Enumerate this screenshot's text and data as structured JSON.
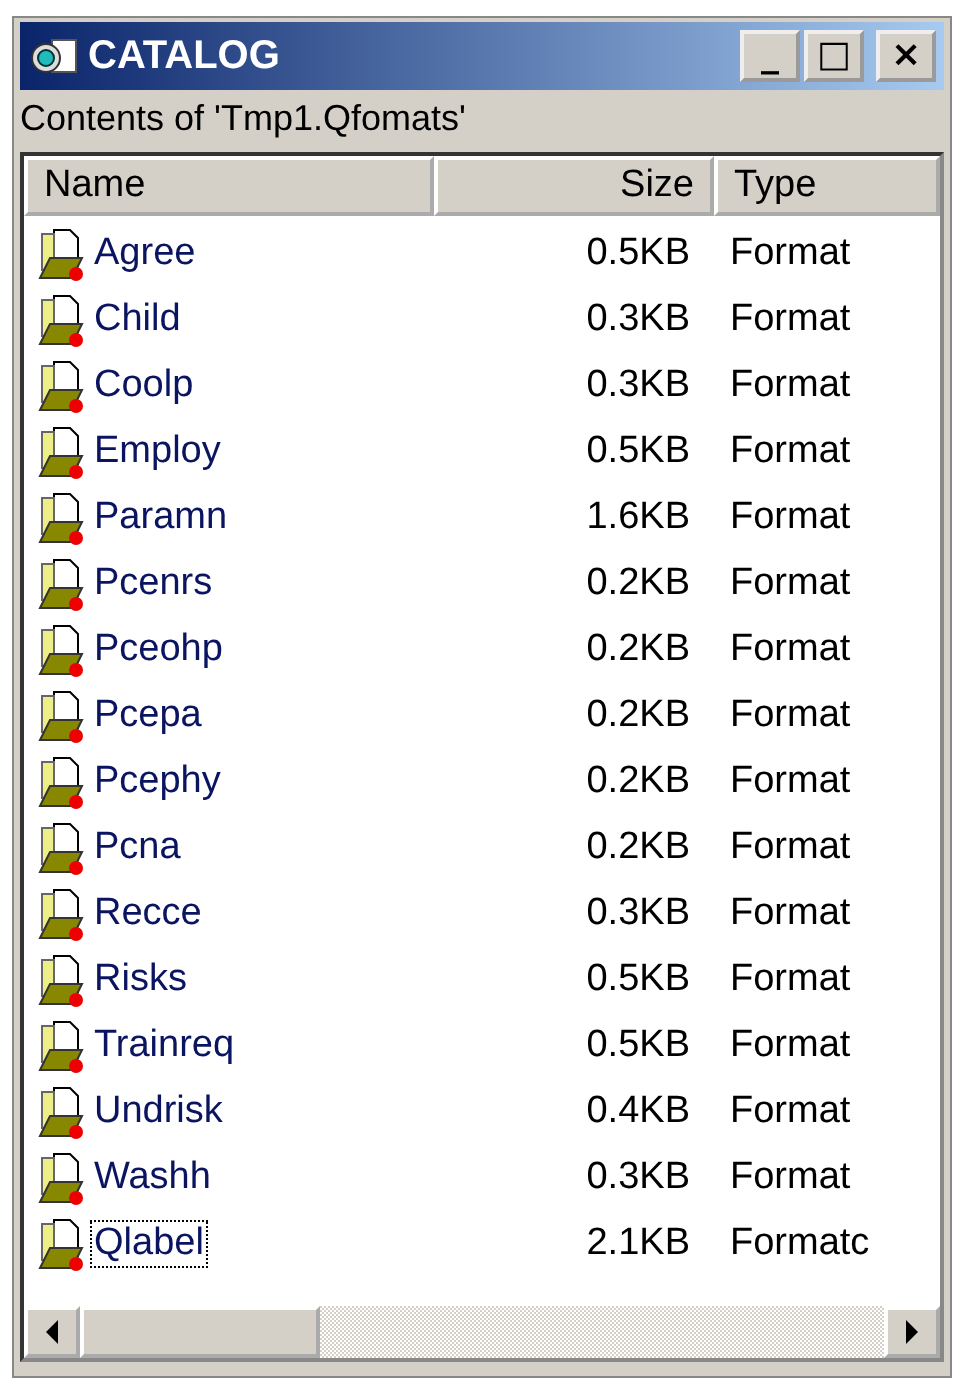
{
  "window": {
    "title": "CATALOG",
    "controls": [
      "_",
      "□",
      "×"
    ]
  },
  "subtitle": "Contents of 'Tmp1.Qfomats'",
  "table": {
    "columns": [
      "Name",
      "Size",
      "Type"
    ],
    "rows": [
      {
        "name": "Agree",
        "size": "0.5KB",
        "type": "Format",
        "focused": false
      },
      {
        "name": "Child",
        "size": "0.3KB",
        "type": "Format",
        "focused": false
      },
      {
        "name": "Coolp",
        "size": "0.3KB",
        "type": "Format",
        "focused": false
      },
      {
        "name": "Employ",
        "size": "0.5KB",
        "type": "Format",
        "focused": false
      },
      {
        "name": "Paramn",
        "size": "1.6KB",
        "type": "Format",
        "focused": false
      },
      {
        "name": "Pcenrs",
        "size": "0.2KB",
        "type": "Format",
        "focused": false
      },
      {
        "name": "Pceohp",
        "size": "0.2KB",
        "type": "Format",
        "focused": false
      },
      {
        "name": "Pcepa",
        "size": "0.2KB",
        "type": "Format",
        "focused": false
      },
      {
        "name": "Pcephy",
        "size": "0.2KB",
        "type": "Format",
        "focused": false
      },
      {
        "name": "Pcna",
        "size": "0.2KB",
        "type": "Format",
        "focused": false
      },
      {
        "name": "Recce",
        "size": "0.3KB",
        "type": "Format",
        "focused": false
      },
      {
        "name": "Risks",
        "size": "0.5KB",
        "type": "Format",
        "focused": false
      },
      {
        "name": "Trainreq",
        "size": "0.5KB",
        "type": "Format",
        "focused": false
      },
      {
        "name": "Undrisk",
        "size": "0.4KB",
        "type": "Format",
        "focused": false
      },
      {
        "name": "Washh",
        "size": "0.3KB",
        "type": "Format",
        "focused": false
      },
      {
        "name": "Qlabel",
        "size": "2.1KB",
        "type": "Formatc",
        "focused": true
      }
    ]
  }
}
